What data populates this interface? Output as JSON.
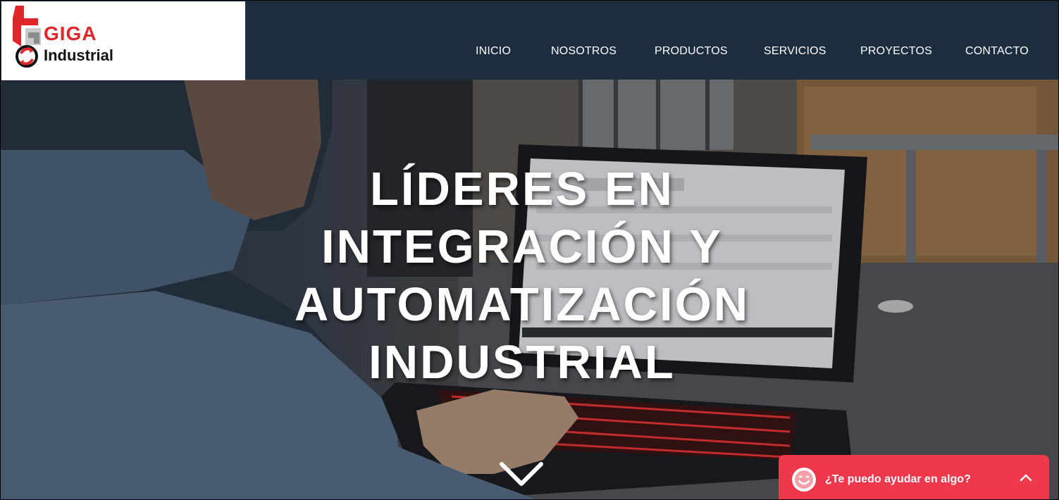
{
  "logo": {
    "brand": "GIGA",
    "subtitle": "Industrial"
  },
  "nav": {
    "items": [
      {
        "label": "INICIO"
      },
      {
        "label": "NOSOTROS"
      },
      {
        "label": "PRODUCTOS"
      },
      {
        "label": "SERVICIOS"
      },
      {
        "label": "PROYECTOS"
      },
      {
        "label": "CONTACTO"
      }
    ]
  },
  "hero": {
    "title_lines": [
      "LÍDERES EN",
      "INTEGRACIÓN Y",
      "AUTOMATIZACIÓN",
      "INDUSTRIAL"
    ],
    "scroll_icon": "chevron-down-icon"
  },
  "chat": {
    "label": "¿Te puedo ayudar en algo?",
    "icon": "smiley-icon",
    "toggle_icon": "chevron-up-icon"
  },
  "colors": {
    "header_bg": "#1d2d40",
    "brand_red": "#e0262b",
    "chat_bg": "#f0384d"
  }
}
